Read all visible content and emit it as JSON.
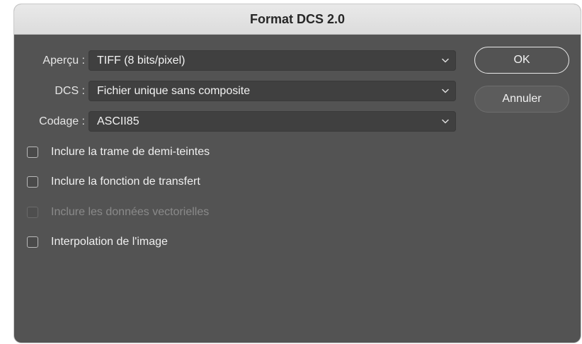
{
  "dialog": {
    "title": "Format DCS 2.0"
  },
  "fields": {
    "apercu": {
      "label": "Aperçu :",
      "value": "TIFF (8 bits/pixel)"
    },
    "dcs": {
      "label": "DCS :",
      "value": "Fichier unique sans composite"
    },
    "codage": {
      "label": "Codage :",
      "value": "ASCII85"
    }
  },
  "buttons": {
    "ok": "OK",
    "cancel": "Annuler"
  },
  "options": [
    {
      "label": "Inclure la trame de demi-teintes",
      "checked": false,
      "enabled": true
    },
    {
      "label": "Inclure la fonction de transfert",
      "checked": false,
      "enabled": true
    },
    {
      "label": "Inclure les données vectorielles",
      "checked": false,
      "enabled": false
    },
    {
      "label": "Interpolation de l'image",
      "checked": false,
      "enabled": true
    }
  ],
  "icons": {
    "select_chevron": "chevron-down-icon"
  }
}
